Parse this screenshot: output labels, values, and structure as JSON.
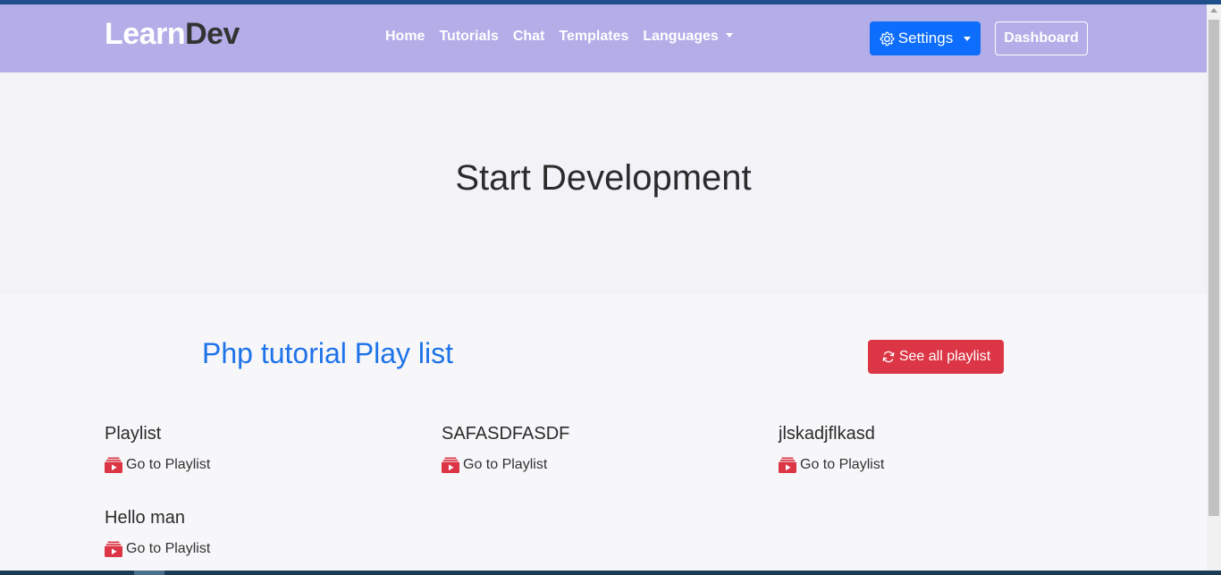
{
  "brand": {
    "part1": "Learn",
    "part2": "Dev"
  },
  "nav": {
    "links": [
      "Home",
      "Tutorials",
      "Chat",
      "Templates",
      "Languages"
    ],
    "settings_label": "Settings",
    "dashboard_label": "Dashboard"
  },
  "hero": {
    "title": "Start Development"
  },
  "section": {
    "title": "Php tutorial Play list",
    "see_all_label": "See all playlist"
  },
  "playlists": [
    {
      "title": "Playlist",
      "link": "Go to Playlist"
    },
    {
      "title": "SAFASDFASDF",
      "link": "Go to Playlist"
    },
    {
      "title": "jlskadjflkasd",
      "link": "Go to Playlist"
    },
    {
      "title": "Hello man",
      "link": "Go to Playlist"
    }
  ],
  "colors": {
    "navbar": "#b3ade8",
    "primary": "#0d6efd",
    "danger": "#dc3545",
    "section_title": "#1e73e8"
  },
  "icons": {
    "settings": "gear-icon",
    "see_all": "refresh-icon",
    "playlist": "youtube-playlist-icon",
    "languages": "chevron-down-icon"
  }
}
